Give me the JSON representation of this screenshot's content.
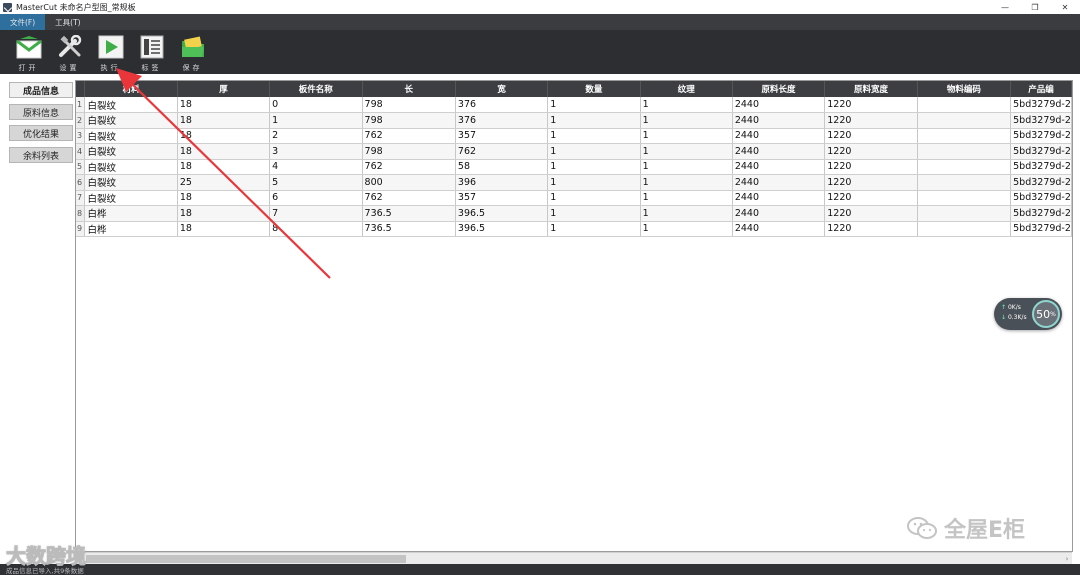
{
  "window": {
    "title": "MasterCut 未命名户型图_常规板",
    "controls": [
      "—",
      "❐",
      "✕"
    ]
  },
  "menu": [
    {
      "label": "文件(F)",
      "active": true
    },
    {
      "label": "工具(T)",
      "active": false
    }
  ],
  "toolbar": [
    {
      "icon": "open-envelope-icon",
      "label": "打开"
    },
    {
      "icon": "wrench-screwdriver-icon",
      "label": "设置"
    },
    {
      "icon": "play-icon",
      "label": "执行"
    },
    {
      "icon": "label-sheet-icon",
      "label": "标签"
    },
    {
      "icon": "save-folder-icon",
      "label": "保存"
    }
  ],
  "sidebar": [
    {
      "label": "成品信息",
      "active": true
    },
    {
      "label": "原料信息",
      "active": false
    },
    {
      "label": "优化结果",
      "active": false
    },
    {
      "label": "余料列表",
      "active": false
    }
  ],
  "grid": {
    "columns": [
      "材料",
      "厚",
      "板件名称",
      "长",
      "宽",
      "数量",
      "纹理",
      "原料长度",
      "原料宽度",
      "物料编码",
      "产品编"
    ],
    "rows": [
      [
        "白裂纹",
        "18",
        "0",
        "798",
        "376",
        "1",
        "1",
        "2440",
        "1220",
        "",
        "5bd3279d-2"
      ],
      [
        "白裂纹",
        "18",
        "1",
        "798",
        "376",
        "1",
        "1",
        "2440",
        "1220",
        "",
        "5bd3279d-2"
      ],
      [
        "白裂纹",
        "18",
        "2",
        "762",
        "357",
        "1",
        "1",
        "2440",
        "1220",
        "",
        "5bd3279d-2"
      ],
      [
        "白裂纹",
        "18",
        "3",
        "798",
        "762",
        "1",
        "1",
        "2440",
        "1220",
        "",
        "5bd3279d-2"
      ],
      [
        "白裂纹",
        "18",
        "4",
        "762",
        "58",
        "1",
        "1",
        "2440",
        "1220",
        "",
        "5bd3279d-2"
      ],
      [
        "白裂纹",
        "25",
        "5",
        "800",
        "396",
        "1",
        "1",
        "2440",
        "1220",
        "",
        "5bd3279d-2"
      ],
      [
        "白裂纹",
        "18",
        "6",
        "762",
        "357",
        "1",
        "1",
        "2440",
        "1220",
        "",
        "5bd3279d-2"
      ],
      [
        "白桦",
        "18",
        "7",
        "736.5",
        "396.5",
        "1",
        "1",
        "2440",
        "1220",
        "",
        "5bd3279d-2"
      ],
      [
        "白桦",
        "18",
        "8",
        "736.5",
        "396.5",
        "1",
        "1",
        "2440",
        "1220",
        "",
        "5bd3279d-2"
      ]
    ]
  },
  "speed_widget": {
    "upload": "0K/s",
    "download": "0.3K/s",
    "percent": "50",
    "percent_unit": "%"
  },
  "statusbar": {
    "text": "成品信息已导入,共9条数据"
  },
  "watermarks": {
    "left": "大数跨境",
    "right": "全屋E柜"
  },
  "colors": {
    "toolbar_bg": "#2c2e31",
    "menu_active": "#2e6f9e",
    "annotation_arrow": "#e8363a",
    "play_green": "#3fae49"
  }
}
